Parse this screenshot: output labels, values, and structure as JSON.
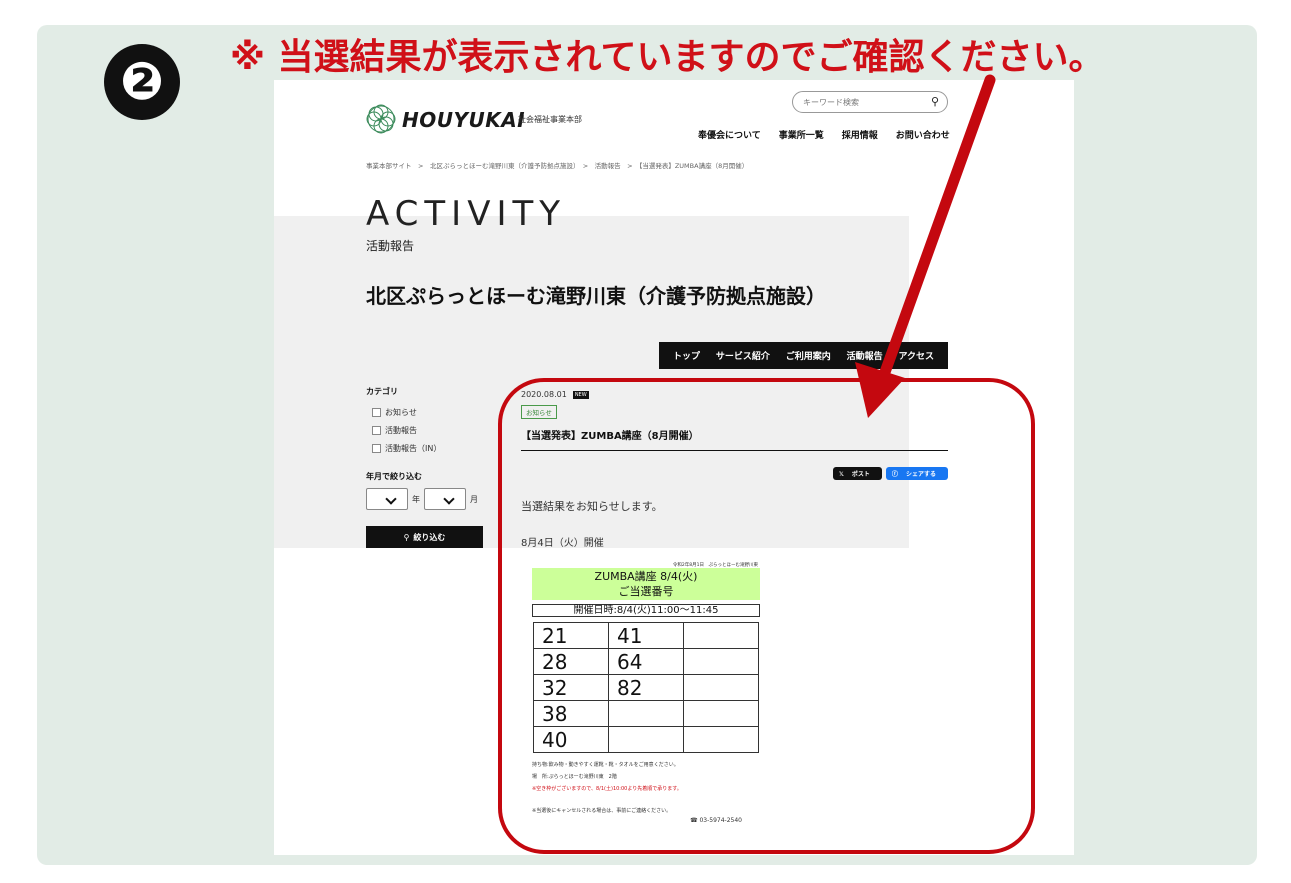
{
  "step_number": "❷",
  "headline": "※ 当選結果が表示されていますのでご確認ください。",
  "site": {
    "logo_text": "HOUYUKAI",
    "logo_sub": "社会福祉事業本部",
    "search_placeholder": "キーワード検索",
    "nav": [
      "奉優会について",
      "事業所一覧",
      "採用情報",
      "お問い合わせ"
    ],
    "breadcrumb": "事業本部サイト　>　北区ぷらっとほーむ滝野川東（介護予防拠点施設）　>　活動報告　>　【当選発表】ZUMBA講座（8月開催）",
    "section_title": "ACTIVITY",
    "section_sub": "活動報告",
    "facility_name": "北区ぷらっとほーむ滝野川東（介護予防拠点施設）",
    "subnav": [
      "トップ",
      "サービス紹介",
      "ご利用案内",
      "活動報告",
      "アクセス"
    ]
  },
  "sidebar": {
    "category_heading": "カテゴリ",
    "categories": [
      "お知らせ",
      "活動報告",
      "活動報告（IN）"
    ],
    "date_heading": "年月で絞り込む",
    "year_suffix": "年",
    "month_suffix": "月",
    "filter_button": "絞り込む"
  },
  "article": {
    "date": "2020.08.01",
    "new_label": "NEW",
    "category": "お知らせ",
    "title": "【当選発表】ZUMBA講座（8月開催）",
    "share_x": "ポスト",
    "share_fb": "シェアする",
    "lead": "当選結果をお知らせします。",
    "event_date": "8月4日（火）開催"
  },
  "notice": {
    "top_note": "令和2年8月1日　ぷらっとほーむ滝野川東",
    "title": "ZUMBA講座  8/4(火)",
    "subtitle": "ご当選番号",
    "time": "開催日時:8/4(火)11:00～11:45",
    "numbers": [
      [
        "21",
        "41",
        ""
      ],
      [
        "28",
        "64",
        ""
      ],
      [
        "32",
        "82",
        ""
      ],
      [
        "38",
        "",
        ""
      ],
      [
        "40",
        "",
        ""
      ]
    ],
    "note1": "持ち物:飲み物・動きやすく運靴・靴・タオルをご用意ください。",
    "note2": "場　所:ぷらっとほーむ滝野川東　2階",
    "note3": "※空き枠がございますので、8/1(土)10:00より先着順で承ります。",
    "note4": "※当選後にキャンセルされる場合は、事前にご連絡ください。",
    "tel": "☎ 03-5974-2540"
  },
  "colors": {
    "accent_red": "#c4080f",
    "panel_bg": "#e2ece6",
    "highlight_green": "#ccff99"
  }
}
